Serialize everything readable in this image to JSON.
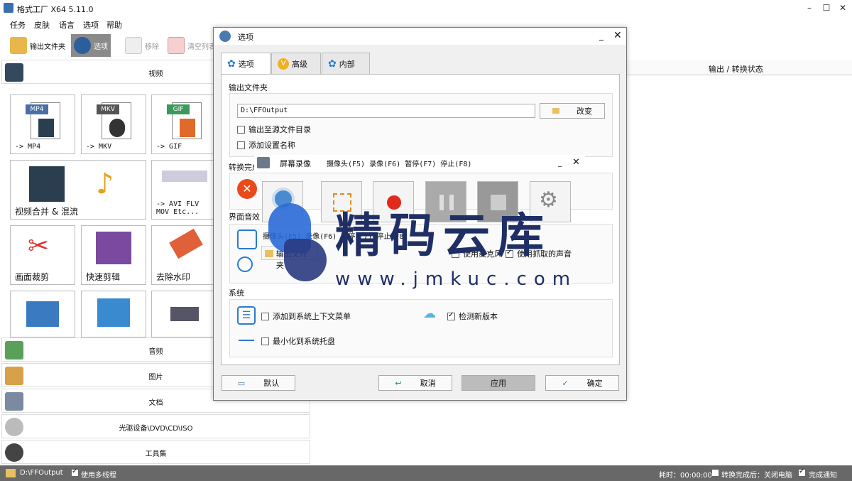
{
  "app": {
    "title": "格式工厂 X64 5.11.0"
  },
  "menu": [
    "任务",
    "皮肤",
    "语言",
    "选项",
    "帮助"
  ],
  "toolbar": {
    "output_folder": "输出文件夹",
    "options": "选项",
    "remove": "移除",
    "clear_list": "清空列表"
  },
  "left": {
    "video_header": "视频",
    "tiles": [
      {
        "label": "-> MP4",
        "badge": "MP4"
      },
      {
        "label": "-> MKV",
        "badge": "MKV"
      },
      {
        "label": "-> GIF",
        "badge": "GIF"
      },
      {
        "label": "视频合并 & 混流"
      },
      {
        "label": "-> AVI FLV\nMOV Etc..."
      },
      {
        "label": "画面裁剪"
      },
      {
        "label": "快速剪辑"
      },
      {
        "label": "去除水印"
      }
    ],
    "categories": [
      "音频",
      "图片",
      "文档",
      "光驱设备\\DVD\\CD\\ISO",
      "工具集"
    ]
  },
  "right": {
    "header": "输出 / 转换状态"
  },
  "status": {
    "path": "D:\\FFOutput",
    "multithread": "使用多线程",
    "time": "耗时：00:00:00",
    "after": "转换完成后：关闭电脑",
    "notify": "完成通知"
  },
  "dialog": {
    "title": "选项",
    "tabs": [
      "选项",
      "高级",
      "内部"
    ],
    "output_folder_section": "输出文件夹",
    "output_path": "D:\\FFOutput",
    "change": "改变",
    "output_to_source": "输出至源文件目录",
    "add_setting_name": "添加设置名称",
    "after_convert_section": "转换完成",
    "ui_sound_section": "界面音效",
    "use_mic": "使用麦克风",
    "use_captured_sound": "使用抓取的声音",
    "system_section": "系统",
    "add_context_menu": "添加到系统上下文菜单",
    "check_update": "检测新版本",
    "minimize_tray": "最小化到系统托盘",
    "buttons": {
      "default": "默认",
      "cancel": "取消",
      "apply": "应用",
      "ok": "确定"
    }
  },
  "recorder": {
    "title": "屏幕录像",
    "hotkeys": "摄像头(F5) 录像(F6) 暂停(F7) 停止(F8)",
    "hotkeys2": "摄像头(F5) 录像(F6) 暂停(F7) 停止(F8)",
    "output_folder": "输出文件夹"
  },
  "watermark": {
    "text": "精码云库",
    "url": "www.jmkuc.com"
  }
}
